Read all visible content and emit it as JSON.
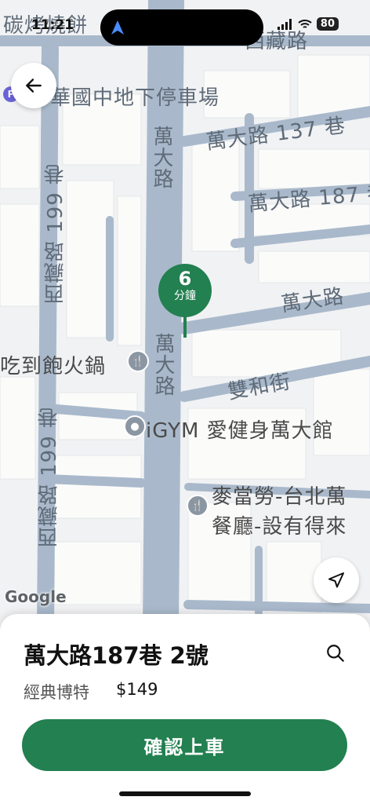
{
  "status_bar": {
    "time": "11:21",
    "battery": "80"
  },
  "map": {
    "labels": {
      "top_left_shop": "碳烤燒餅",
      "top_right_road": "西藏路",
      "parking": "華國中地下停車場",
      "lane_137": "萬大路 137 巷",
      "lane_187": "萬大路 187 巷",
      "wanda_upper": "萬大路",
      "wanda_lower": "萬大路",
      "wanda_right": "萬大路",
      "xizang_upper": "西藏路 199 巷",
      "xizang_lower": "西藏路 199 巷",
      "shuanghe": "雙和街",
      "hotpot": "吃到飽火鍋",
      "gym": "iGYM 愛健身萬大館",
      "mcd_line1": "麥當勞-台北萬",
      "mcd_line2": "餐廳-設有得來",
      "parking_badge": "P"
    },
    "eta": {
      "number": "6",
      "unit": "分鐘"
    },
    "attribution": "Google",
    "colors": {
      "road": "#a9b9cb",
      "block": "#fbfbfa",
      "accent": "#238050"
    }
  },
  "buttons": {
    "back_icon": "arrow-left-icon",
    "locate_icon": "navigation-arrow-icon"
  },
  "sheet": {
    "destination": "萬大路187巷 2號",
    "service": "經典博特",
    "price": "$149",
    "confirm_label": "確認上車",
    "search_icon": "search-icon"
  }
}
